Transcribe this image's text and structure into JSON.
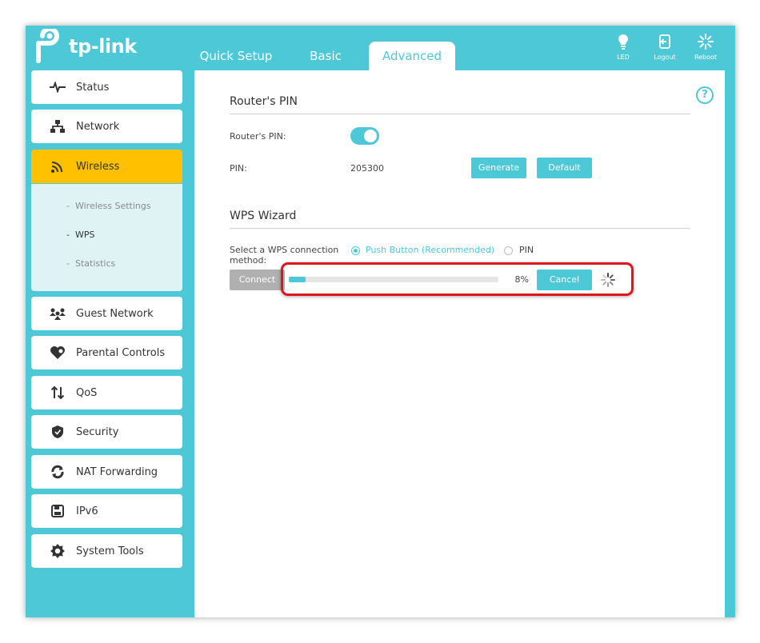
{
  "brand": {
    "name": "tp-link"
  },
  "tabs": [
    {
      "label": "Quick Setup"
    },
    {
      "label": "Basic"
    },
    {
      "label": "Advanced"
    }
  ],
  "top_actions": [
    {
      "label": "LED",
      "icon": "bulb-icon"
    },
    {
      "label": "Logout",
      "icon": "logout-icon"
    },
    {
      "label": "Reboot",
      "icon": "reboot-icon"
    }
  ],
  "sidebar": {
    "items": [
      {
        "label": "Status",
        "icon": "pulse-icon"
      },
      {
        "label": "Network",
        "icon": "network-icon"
      },
      {
        "label": "Wireless",
        "icon": "wifi-icon"
      },
      {
        "label": "Guest Network",
        "icon": "guests-icon"
      },
      {
        "label": "Parental Controls",
        "icon": "heart-icon"
      },
      {
        "label": "QoS",
        "icon": "arrows-updown-icon"
      },
      {
        "label": "Security",
        "icon": "shield-icon"
      },
      {
        "label": "NAT Forwarding",
        "icon": "refresh-icon"
      },
      {
        "label": "IPv6",
        "icon": "document-icon"
      },
      {
        "label": "System Tools",
        "icon": "gear-icon"
      }
    ],
    "wireless_sub": [
      {
        "label": "Wireless Settings"
      },
      {
        "label": "WPS"
      },
      {
        "label": "Statistics"
      }
    ]
  },
  "routers_pin": {
    "title": "Router's PIN",
    "toggle_label": "Router's PIN:",
    "toggle_on": true,
    "pin_label": "PIN:",
    "pin_value": "205300",
    "generate_label": "Generate",
    "default_label": "Default"
  },
  "wps": {
    "title": "WPS Wizard",
    "method_label": "Select a WPS connection method:",
    "option_push": "Push Button (Recommended)",
    "option_pin": "PIN",
    "selected": "push",
    "connect_label": "Connect",
    "progress_percent": 8,
    "progress_text": "8%",
    "cancel_label": "Cancel"
  },
  "colors": {
    "accent": "#4dc8d6",
    "active_menu": "#ffc000",
    "highlight": "#e0141e"
  }
}
